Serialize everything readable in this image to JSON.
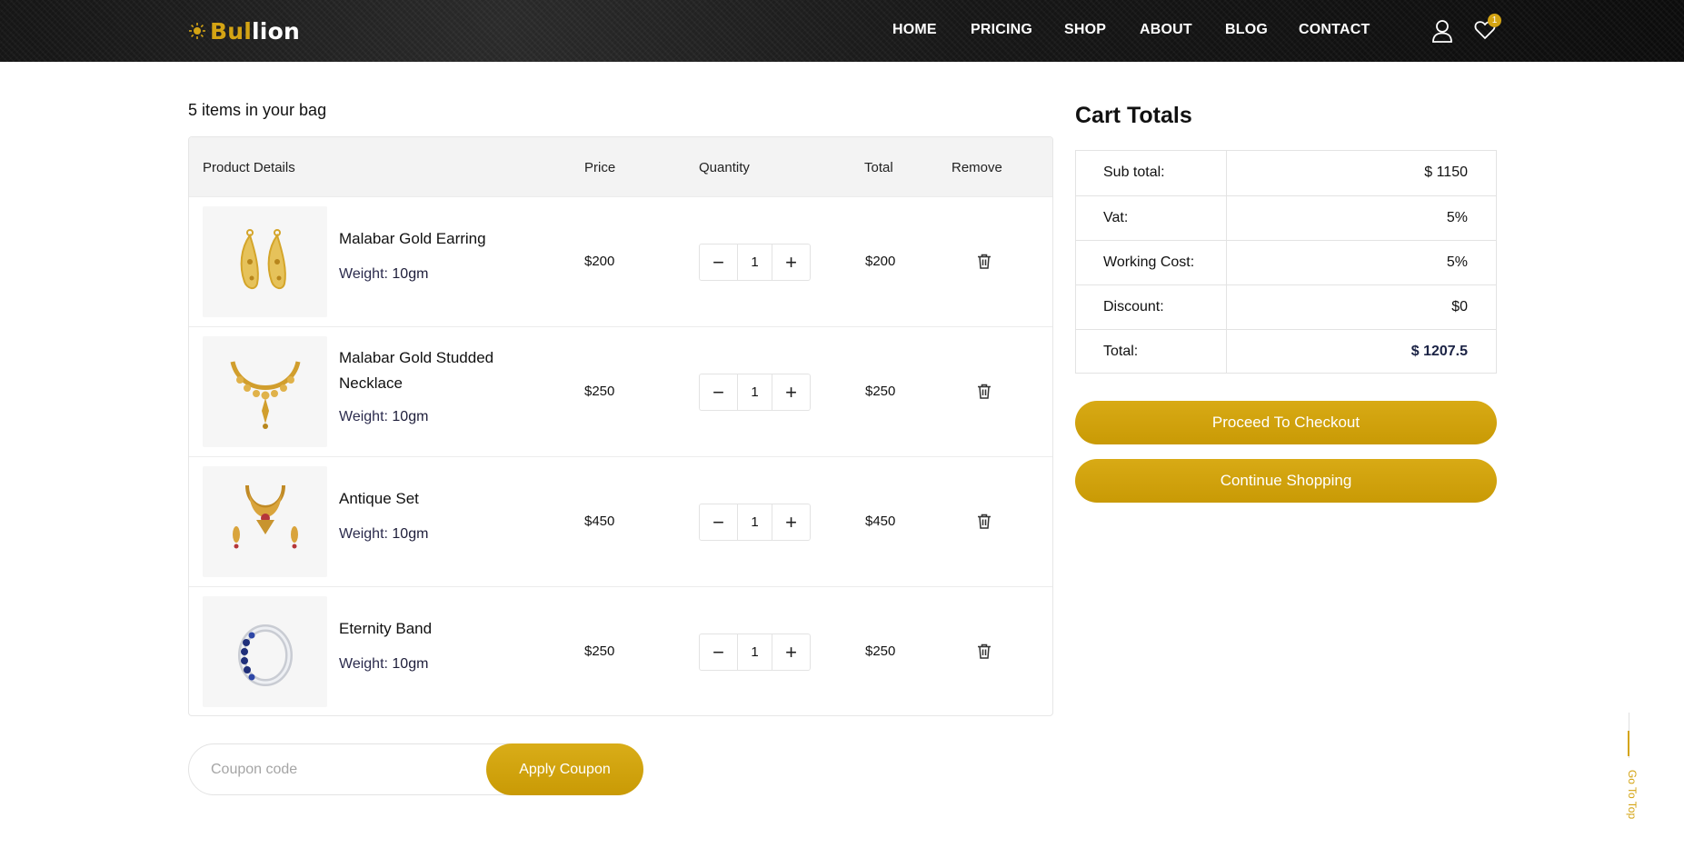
{
  "header": {
    "logo": {
      "part1": "Bul",
      "part2": "lion"
    },
    "nav": [
      {
        "label": "HOME"
      },
      {
        "label": "PRICING"
      },
      {
        "label": "SHOP"
      },
      {
        "label": "ABOUT"
      },
      {
        "label": "BLOG"
      },
      {
        "label": "CONTACT"
      }
    ],
    "wishlist_count": "1",
    "icons": {
      "user": "user-icon",
      "wishlist": "heart-icon",
      "logo": "sun-ornament-icon"
    }
  },
  "bag": {
    "title": "5 items in your bag",
    "columns": {
      "product": "Product Details",
      "price": "Price",
      "quantity": "Quantity",
      "total": "Total",
      "remove": "Remove"
    },
    "weight_label": "Weight:",
    "items": [
      {
        "name": "Malabar Gold Earring",
        "weight": "10gm",
        "price": "$200",
        "qty": "1",
        "total": "$200",
        "image": "gold-earrings"
      },
      {
        "name": "Malabar Gold Studded Necklace",
        "weight": "10gm",
        "price": "$250",
        "qty": "1",
        "total": "$250",
        "image": "gold-necklace"
      },
      {
        "name": "Antique Set",
        "weight": "10gm",
        "price": "$450",
        "qty": "1",
        "total": "$450",
        "image": "antique-set"
      },
      {
        "name": "Eternity Band",
        "weight": "10gm",
        "price": "$250",
        "qty": "1",
        "total": "$250",
        "image": "eternity-ring"
      }
    ],
    "qty_minus": "−",
    "qty_plus": "+"
  },
  "coupon": {
    "placeholder": "Coupon code",
    "button": "Apply Coupon"
  },
  "totals": {
    "title": "Cart Totals",
    "rows": [
      {
        "label": "Sub total:",
        "value": "$ 1150"
      },
      {
        "label": "Vat:",
        "value": "5%"
      },
      {
        "label": "Working Cost:",
        "value": "5%"
      },
      {
        "label": "Discount:",
        "value": "$0"
      },
      {
        "label": "Total:",
        "value": "$ 1207.5"
      }
    ],
    "checkout_button": "Proceed To Checkout",
    "continue_button": "Continue Shopping"
  },
  "go_to_top": "Go To Top",
  "colors": {
    "gold": "#d4a414",
    "dark": "#111111",
    "navy": "#1b2345"
  }
}
